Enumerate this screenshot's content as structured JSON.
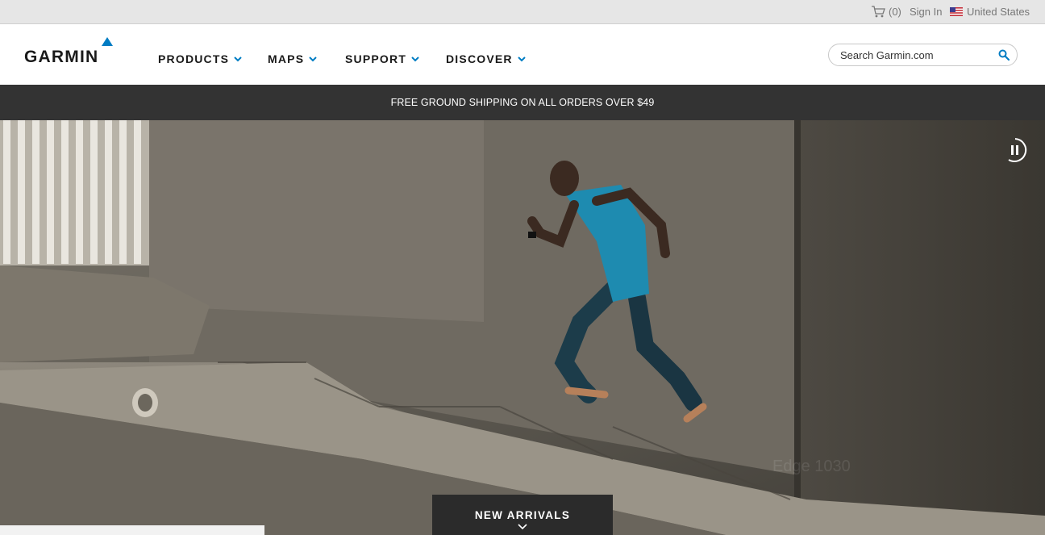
{
  "utility_bar": {
    "cart_count": "(0)",
    "sign_in": "Sign In",
    "country": "United States"
  },
  "header": {
    "logo_text": "GARMIN",
    "nav": [
      {
        "label": "PRODUCTS"
      },
      {
        "label": "MAPS"
      },
      {
        "label": "SUPPORT"
      },
      {
        "label": "DISCOVER"
      }
    ],
    "search": {
      "placeholder": "Search Garmin.com",
      "value": ""
    }
  },
  "promo": {
    "text": "FREE GROUND SHIPPING ON ALL ORDERS OVER $49"
  },
  "hero": {
    "caption": "Edge 1030",
    "cta": "NEW ARRIVALS"
  },
  "colors": {
    "brand_blue": "#007cc3",
    "promo_bg": "#333333",
    "cta_bg": "#2b2b2b",
    "shirt": "#1e8bb0"
  },
  "icons": {
    "cart": "cart-icon",
    "flag": "us-flag-icon",
    "search": "search-icon",
    "chevron": "chevron-down-icon",
    "pause": "pause-icon"
  }
}
